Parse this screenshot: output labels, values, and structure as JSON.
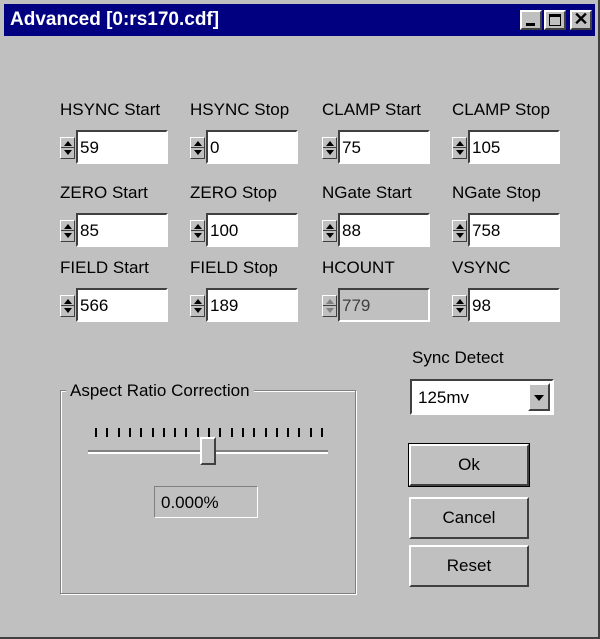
{
  "window": {
    "title": "Advanced [0:rs170.cdf]"
  },
  "fields": [
    {
      "label": "HSYNC Start",
      "value": "59",
      "enabled": true
    },
    {
      "label": "HSYNC Stop",
      "value": "0",
      "enabled": true
    },
    {
      "label": "CLAMP Start",
      "value": "75",
      "enabled": true
    },
    {
      "label": "CLAMP Stop",
      "value": "105",
      "enabled": true
    },
    {
      "label": "ZERO Start",
      "value": "85",
      "enabled": true
    },
    {
      "label": "ZERO Stop",
      "value": "100",
      "enabled": true
    },
    {
      "label": "NGate Start",
      "value": "88",
      "enabled": true
    },
    {
      "label": "NGate Stop",
      "value": "758",
      "enabled": true
    },
    {
      "label": "FIELD Start",
      "value": "566",
      "enabled": true
    },
    {
      "label": "FIELD Stop",
      "value": "189",
      "enabled": true
    },
    {
      "label": "HCOUNT",
      "value": "779",
      "enabled": false
    },
    {
      "label": "VSYNC",
      "value": "98",
      "enabled": true
    }
  ],
  "sync": {
    "label": "Sync Detect",
    "value": "125mv"
  },
  "aspect": {
    "label": "Aspect Ratio Correction",
    "value": "0.000%",
    "slider_position": 0.5
  },
  "buttons": {
    "ok": "Ok",
    "cancel": "Cancel",
    "reset": "Reset"
  },
  "icons": {
    "minimize": "minimize-icon",
    "maximize": "maximize-icon",
    "close": "close-icon"
  }
}
